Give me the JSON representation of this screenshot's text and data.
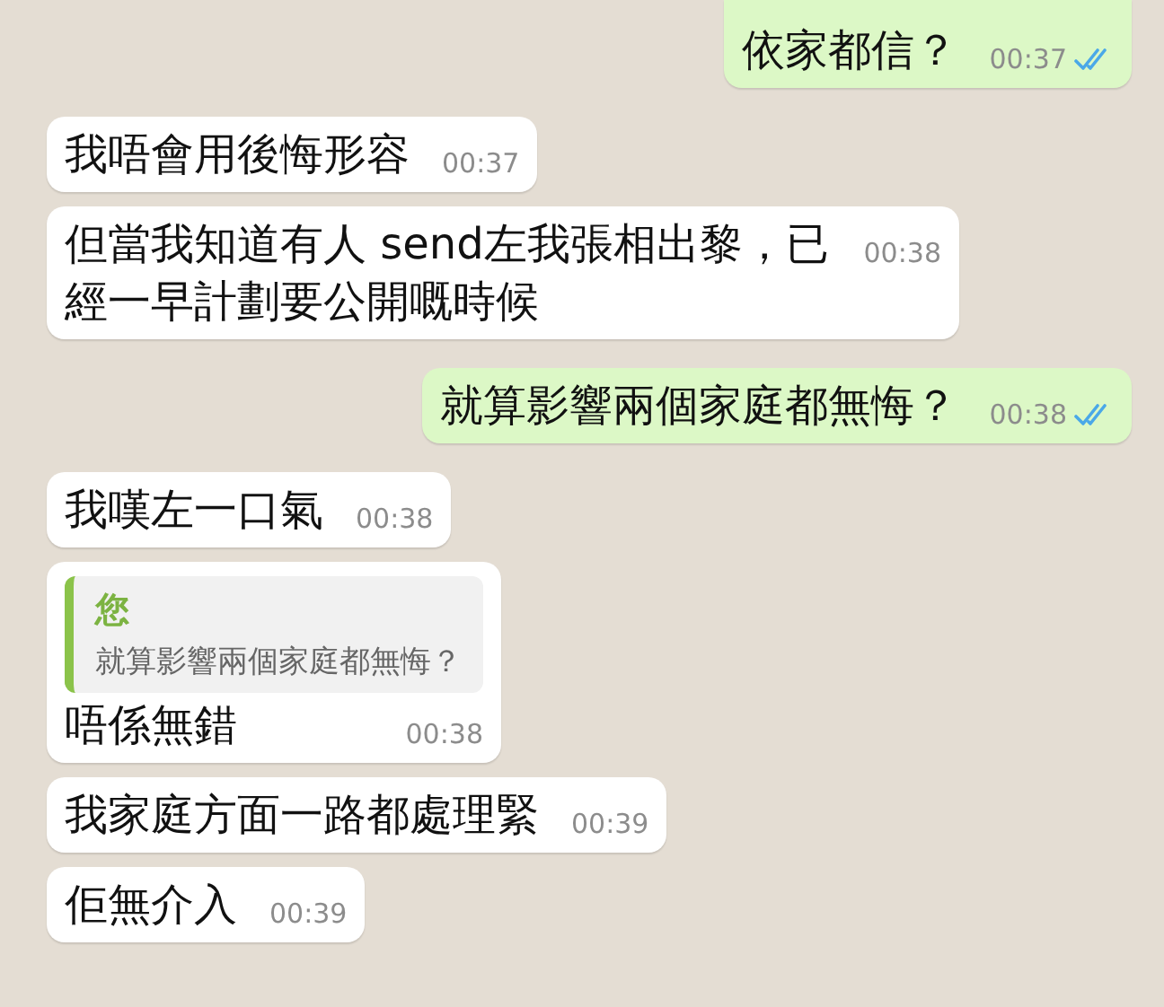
{
  "messages": [
    {
      "outgoing": true,
      "text": "依家都信？",
      "time": "00:37",
      "read": true
    },
    {
      "outgoing": false,
      "text": "我唔會用後悔形容",
      "time": "00:37"
    },
    {
      "outgoing": false,
      "text": "但當我知道有人 send左我張相出黎，已經一早計劃要公開嘅時候",
      "time": "00:38"
    },
    {
      "outgoing": true,
      "text": "就算影響兩個家庭都無悔？",
      "time": "00:38",
      "read": true
    },
    {
      "outgoing": false,
      "text": "我嘆左一口氣",
      "time": "00:38"
    },
    {
      "outgoing": false,
      "quote": {
        "author": "您",
        "text": "就算影響兩個家庭都無悔？"
      },
      "text": "唔係無錯",
      "time": "00:38"
    },
    {
      "outgoing": false,
      "text": "我家庭方面一路都處理緊",
      "time": "00:39"
    },
    {
      "outgoing": false,
      "text": "佢無介入",
      "time": "00:39"
    }
  ]
}
